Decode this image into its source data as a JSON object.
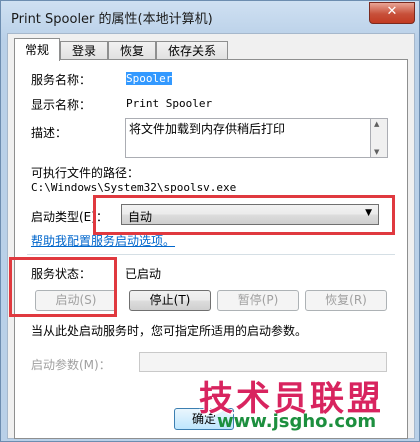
{
  "window": {
    "title": "Print Spooler 的属性(本地计算机)",
    "close_label": "✕"
  },
  "tabs": [
    {
      "label": "常规"
    },
    {
      "label": "登录"
    },
    {
      "label": "恢复"
    },
    {
      "label": "依存关系"
    }
  ],
  "general": {
    "service_name_label": "服务名称：",
    "service_name_value": "Spooler",
    "display_name_label": "显示名称：",
    "display_name_value": "Print Spooler",
    "description_label": "描述：",
    "description_value": "将文件加载到内存供稍后打印",
    "exe_path_label": "可执行文件的路径：",
    "exe_path_value": "C:\\Windows\\System32\\spoolsv.exe",
    "startup_type_label": "启动类型(E)：",
    "startup_type_value": "自动",
    "help_link": "帮助我配置服务启动选项。",
    "status_label": "服务状态：",
    "status_value": "已启动",
    "start_button": "启动(S)",
    "stop_button": "停止(T)",
    "pause_button": "暂停(P)",
    "resume_button": "恢复(R)",
    "hint": "当从此处启动服务时，您可指定所适用的启动参数。",
    "start_params_label": "启动参数(M)："
  },
  "footer": {
    "ok_button": "确定"
  },
  "watermark": {
    "text": "技术员联盟",
    "url": "www.jsgho.com"
  },
  "colors": {
    "highlight_box": "#e0393f",
    "link": "#0066cc",
    "selection": "#3399ff"
  }
}
